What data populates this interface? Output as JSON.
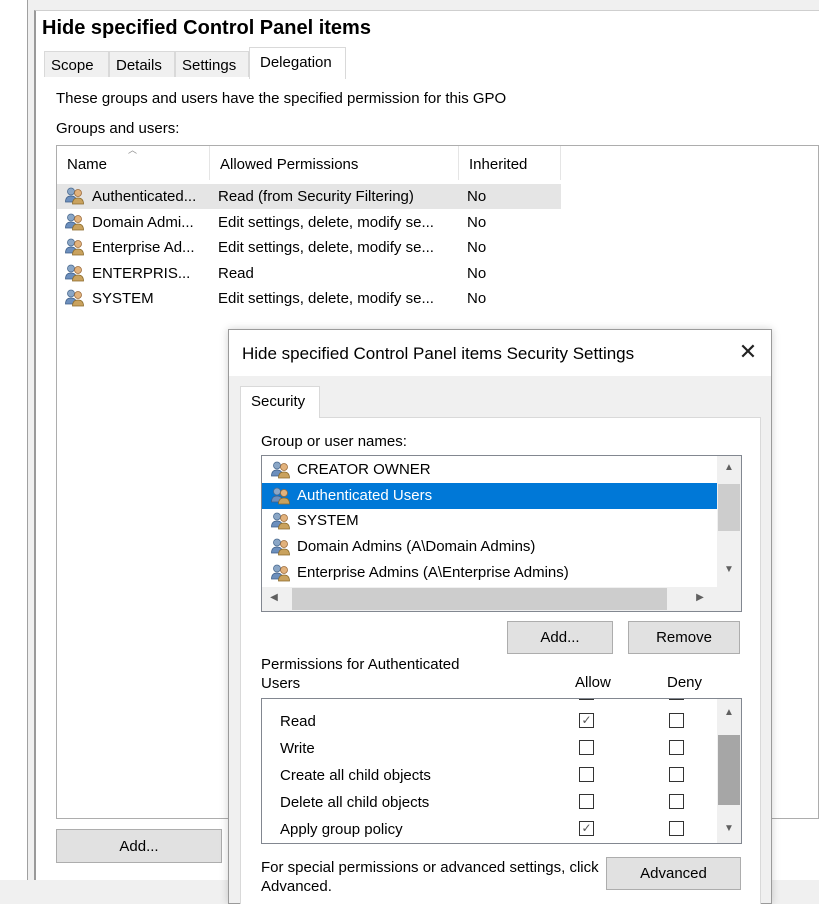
{
  "gpo": {
    "title": "Hide specified Control Panel items",
    "tabs": [
      "Scope",
      "Details",
      "Settings",
      "Delegation"
    ],
    "active_tab": "Delegation",
    "info_text": "These groups and users have the specified permission for this GPO",
    "groups_label": "Groups and users:",
    "columns": {
      "name": "Name",
      "allowed": "Allowed Permissions",
      "inherited": "Inherited"
    },
    "rows": [
      {
        "name": "Authenticated...",
        "allowed": "Read (from Security Filtering)",
        "inherited": "No"
      },
      {
        "name": "Domain Admi...",
        "allowed": "Edit settings, delete, modify se...",
        "inherited": "No"
      },
      {
        "name": "Enterprise Ad...",
        "allowed": "Edit settings, delete, modify se...",
        "inherited": "No"
      },
      {
        "name": "ENTERPRIS...",
        "allowed": "Read",
        "inherited": "No"
      },
      {
        "name": "SYSTEM",
        "allowed": "Edit settings, delete, modify se...",
        "inherited": "No"
      }
    ],
    "add_button": "Add..."
  },
  "dialog": {
    "title": "Hide specified Control Panel items Security Settings",
    "close_glyph": "✕",
    "tab": "Security",
    "group_label": "Group or user names:",
    "users": [
      "CREATOR OWNER",
      "Authenticated Users",
      "SYSTEM",
      "Domain Admins (A\\Domain Admins)",
      "Enterprise Admins (A\\Enterprise Admins)"
    ],
    "selected_user": "Authenticated Users",
    "add_button": "Add...",
    "remove_button": "Remove",
    "permissions_label": "Permissions for Authenticated Users",
    "allow_header": "Allow",
    "deny_header": "Deny",
    "permissions": [
      {
        "name": "Read",
        "allow": true,
        "deny": false
      },
      {
        "name": "Write",
        "allow": false,
        "deny": false
      },
      {
        "name": "Create all child objects",
        "allow": false,
        "deny": false
      },
      {
        "name": "Delete all child objects",
        "allow": false,
        "deny": false
      },
      {
        "name": "Apply group policy",
        "allow": true,
        "deny": false
      }
    ],
    "special_text": "For special permissions or advanced settings, click Advanced.",
    "advanced_button": "Advanced"
  },
  "colors": {
    "selection": "#0078d7",
    "row_highlight": "#e5e5e5",
    "button_face": "#e1e1e1"
  },
  "icons": {
    "user_group": "user-group-icon",
    "close": "close-icon",
    "check": "check-icon"
  }
}
